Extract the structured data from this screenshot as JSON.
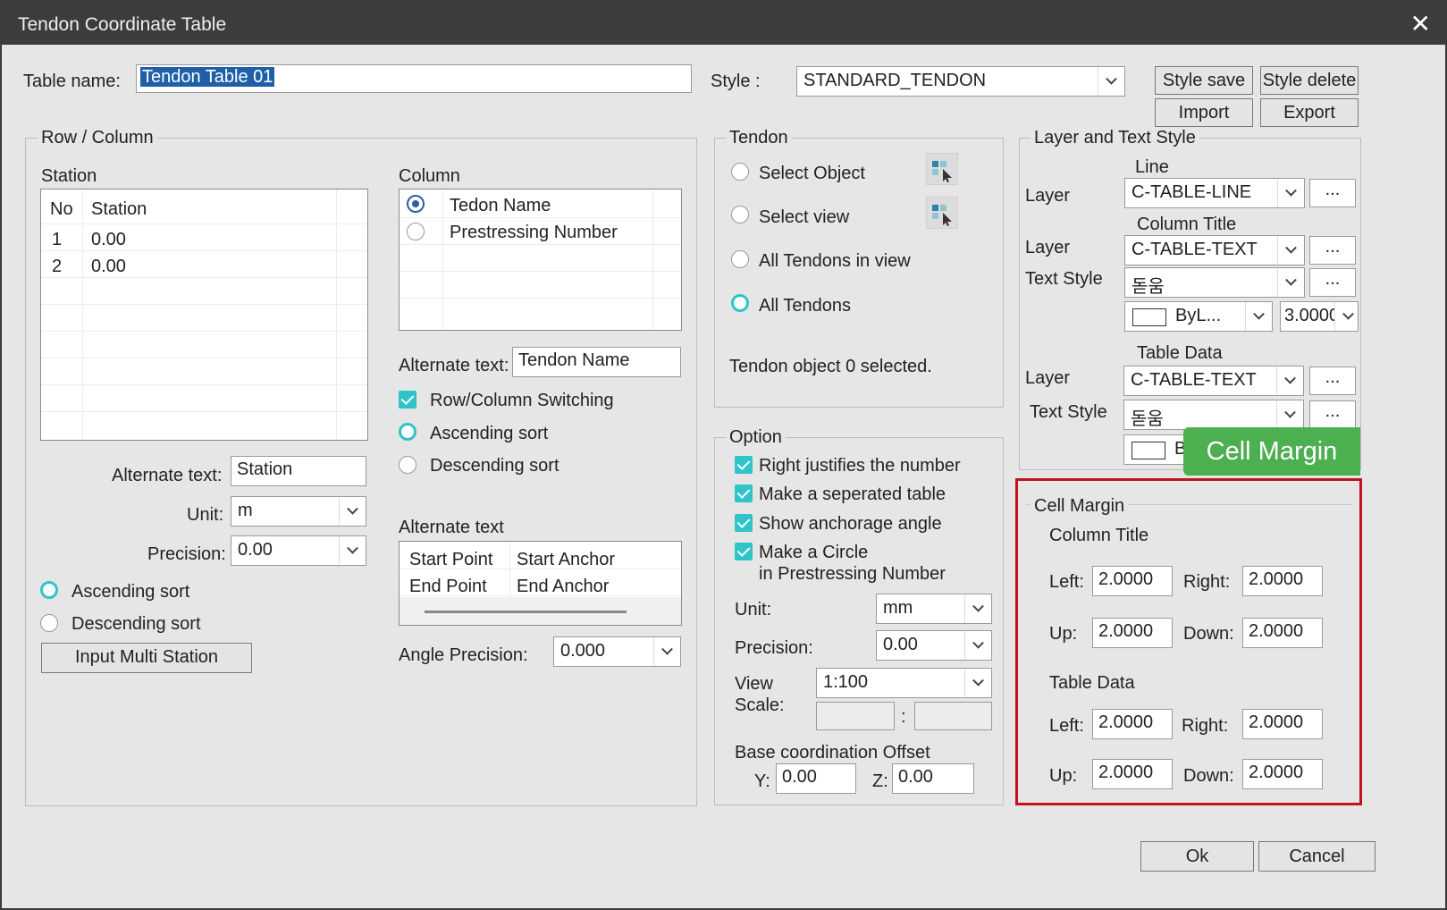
{
  "window": {
    "title": "Tendon Coordinate Table",
    "close": "✕"
  },
  "table_name": {
    "label": "Table name:",
    "value": "Tendon Table 01"
  },
  "style": {
    "label": "Style :",
    "value": "STANDARD_TENDON",
    "save": "Style save",
    "delete": "Style delete",
    "import": "Import",
    "export": "Export"
  },
  "row_column": {
    "group": "Row / Column",
    "station": {
      "label": "Station",
      "headers": [
        "No",
        "Station"
      ],
      "rows": [
        [
          "1",
          "0.00"
        ],
        [
          "2",
          "0.00"
        ]
      ]
    },
    "alt_label": "Alternate text:",
    "alt_value": "Station",
    "unit_label": "Unit:",
    "unit_value": "m",
    "precision_label": "Precision:",
    "precision_value": "0.00",
    "asc": "Ascending sort",
    "desc": "Descending sort",
    "multi_station": "Input Multi Station",
    "column": {
      "label": "Column",
      "items": [
        "Tedon Name",
        "Prestressing Number"
      ]
    },
    "col_alt_label": "Alternate text:",
    "col_alt_value": "Tendon Name",
    "switching": "Row/Column Switching",
    "col_asc": "Ascending sort",
    "col_desc": "Descending sort",
    "alt_text_label": "Alternate text",
    "alt_rows": [
      [
        "Start Point",
        "Start Anchor"
      ],
      [
        "End Point",
        "End Anchor"
      ]
    ],
    "angle_label": "Angle Precision:",
    "angle_value": "0.000"
  },
  "tendon": {
    "group": "Tendon",
    "options": [
      "Select Object",
      "Select view",
      "All Tendons in view",
      "All Tendons"
    ],
    "status": "Tendon object 0 selected."
  },
  "option": {
    "group": "Option",
    "checks": [
      "Right justifies the number",
      "Make a seperated table",
      "Show anchorage angle",
      "Make a Circle",
      "in Prestressing Number"
    ],
    "unit_label": "Unit:",
    "unit_value": "mm",
    "precision_label": "Precision:",
    "precision_value": "0.00",
    "view_label": "View",
    "scale_label": "Scale:",
    "scale_value": "1:100",
    "colon": ":",
    "base_label": "Base coordination Offset",
    "y_label": "Y:",
    "y_value": "0.00",
    "z_label": "Z:",
    "z_value": "0.00"
  },
  "layer_text": {
    "group": "Layer and Text Style",
    "line_label": "Line",
    "col_title_label": "Column Title",
    "table_data_label": "Table Data",
    "layer_label": "Layer",
    "text_style_label": "Text Style",
    "line_layer": "C-TABLE-LINE",
    "ct_layer": "C-TABLE-TEXT",
    "ct_style": "돋움",
    "color_value": "ByL...",
    "height_value": "3.0000",
    "td_layer": "C-TABLE-TEXT",
    "td_style": "돋움",
    "td_color_value": "B",
    "dots": "..."
  },
  "cell_margin": {
    "callout": "Cell Margin",
    "group": "Cell Margin",
    "column_title": "Column Title",
    "table_data": "Table Data",
    "left_label": "Left:",
    "right_label": "Right:",
    "up_label": "Up:",
    "down_label": "Down:",
    "ct": {
      "left": "2.0000",
      "right": "2.0000",
      "up": "2.0000",
      "down": "2.0000"
    },
    "td": {
      "left": "2.0000",
      "right": "2.0000",
      "up": "2.0000",
      "down": "2.0000"
    }
  },
  "footer": {
    "ok": "Ok",
    "cancel": "Cancel"
  },
  "colors": {
    "accent": "#2ec4c8",
    "callout": "#4caf50",
    "highlight_border": "#c0141c",
    "selection": "#1e5fa8"
  }
}
